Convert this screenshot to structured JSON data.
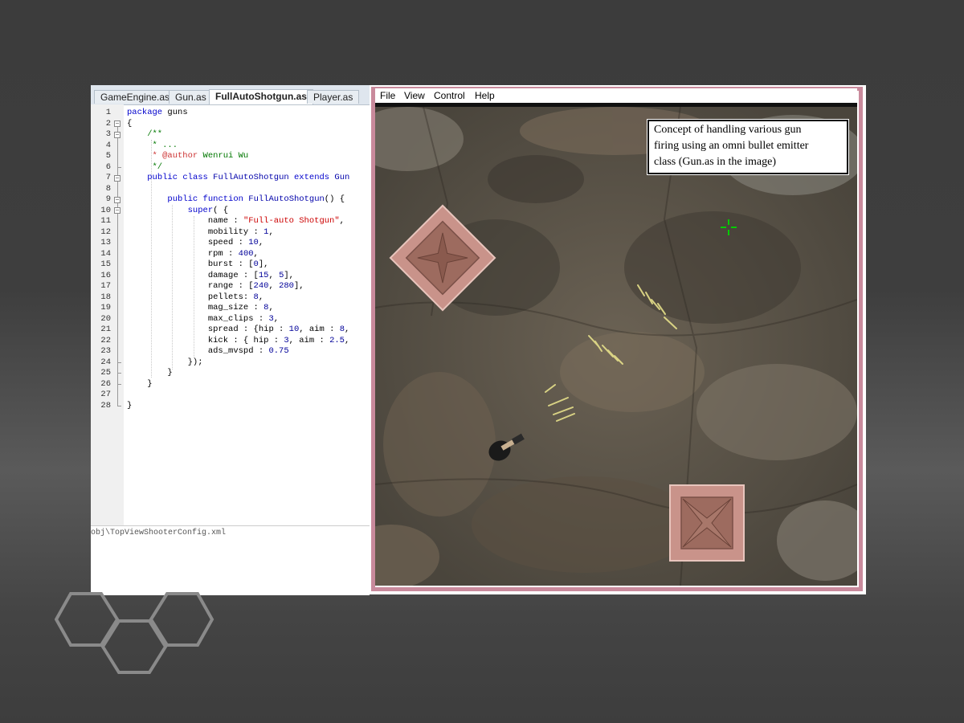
{
  "editor": {
    "tabs": [
      "GameEngine.as",
      "Gun.as",
      "FullAutoShotgun.as",
      "Player.as"
    ],
    "active_tab": "FullAutoShotgun.as",
    "line_numbers": [
      "1",
      "2",
      "3",
      "4",
      "5",
      "6",
      "7",
      "8",
      "9",
      "10",
      "11",
      "12",
      "13",
      "14",
      "15",
      "16",
      "17",
      "18",
      "19",
      "20",
      "21",
      "22",
      "23",
      "24",
      "25",
      "26",
      "27",
      "28"
    ],
    "code": {
      "l1_kw": "package",
      "l1_rest": " guns",
      "l2": "{",
      "l3": "    /**",
      "l4": "     * ...",
      "l5_a": "     * @author ",
      "l5_b": "Wenrui Wu",
      "l6": "     */",
      "l7_kw1": "public",
      "l7_kw2": "class",
      "l7_name": "FullAutoShotgun",
      "l7_kw3": "extends",
      "l7_kw4": "Gun",
      "l9_kw1": "public",
      "l9_kw2": "function",
      "l9_name": "FullAutoShotgun",
      "l9_rest": "() {",
      "l10_kw": "super",
      "l10_rest": "( {",
      "l11_a": "name : ",
      "l11_str": "\"Full-auto Shotgun\"",
      "l11_b": ",",
      "l12_a": "mobility : ",
      "l12_n": "1",
      "l12_b": ",",
      "l13_a": "speed : ",
      "l13_n": "10",
      "l13_b": ",",
      "l14_a": "rpm : ",
      "l14_n": "400",
      "l14_b": ",",
      "l15_a": "burst : [",
      "l15_n": "0",
      "l15_b": "],",
      "l16_a": "damage : [",
      "l16_n1": "15",
      "l16_m": ", ",
      "l16_n2": "5",
      "l16_b": "],",
      "l17_a": "range : [",
      "l17_n1": "240",
      "l17_m": ", ",
      "l17_n2": "280",
      "l17_b": "],",
      "l18_a": "pellets: ",
      "l18_n": "8",
      "l18_b": ",",
      "l19_a": "mag_size : ",
      "l19_n": "8",
      "l19_b": ",",
      "l20_a": "max_clips : ",
      "l20_n": "3",
      "l20_b": ",",
      "l21_a": "spread : {hip : ",
      "l21_n1": "10",
      "l21_m": ", aim : ",
      "l21_n2": "8",
      "l21_b": ",",
      "l22_a": "kick : { hip : ",
      "l22_n1": "3",
      "l22_m": ", aim : ",
      "l22_n2": "2.5",
      "l22_b": ",",
      "l23_a": "ads_mvspd : ",
      "l23_n": "0.75",
      "l24": "});",
      "l25": "}",
      "l26": "}",
      "l28": "}"
    },
    "output_path": "obj\\TopViewShooterConfig.xml"
  },
  "game": {
    "menu": [
      "File",
      "View",
      "Control",
      "Help"
    ],
    "caption_lines": [
      "Concept of handling various gun",
      "firing using an omni bullet emitter",
      "class (Gun.as in the image)"
    ],
    "crosshair_color": "#00cc00",
    "border_color": "#c98a9c"
  }
}
